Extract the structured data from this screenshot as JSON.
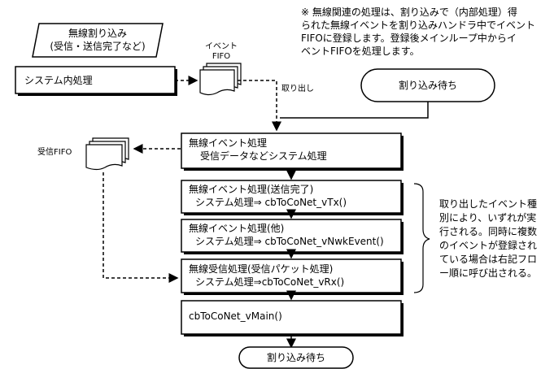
{
  "note": {
    "line1": "※ 無線関連の処理は、割り込みで（内部処理）得",
    "line2": "られた無線イベントを割り込みハンドラ中でイベント",
    "line3": "FIFOに登録します。登録後メインループ中からイ",
    "line4": "ベントFIFOを処理します。"
  },
  "interrupt": {
    "line1": "無線割り込み",
    "line2": "(受信・送信完了など)"
  },
  "system_internal": "システム内処理",
  "event_fifo": {
    "line1": "イベント",
    "line2": "FIFO"
  },
  "take_out": "取り出し",
  "wait_top": "割り込み待ち",
  "recv_fifo": "受信FIFO",
  "event_proc": {
    "line1": "無線イベント処理",
    "line2": "受信データなどシステム処理"
  },
  "tx_done": {
    "line1": "無線イベント処理(送信完了)",
    "line2": "システム処理⇒ cbToCoNet_vTx()"
  },
  "other": {
    "line1": "無線イベント処理(他)",
    "line2": "システム処理⇒ cbToCoNet_vNwkEvent()"
  },
  "rx": {
    "line1": "無線受信処理(受信パケット処理)",
    "line2": "システム処理⇒cbToCoNet_vRx()"
  },
  "main": "cbToCoNet_vMain()",
  "wait_bottom": "割り込み待ち",
  "brace_note": {
    "line1": "取り出したイベント種",
    "line2": "別により、いずれが実",
    "line3": "行される。同時に複数",
    "line4": "のイベントが登録され",
    "line5": "ている場合は右記フロ",
    "line6": "ー順に呼び出される。"
  }
}
